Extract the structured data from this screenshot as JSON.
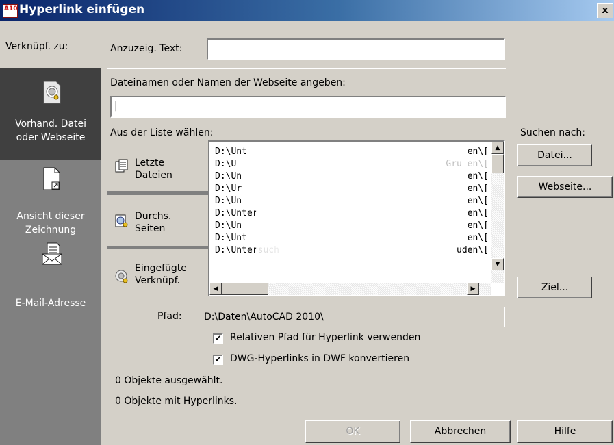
{
  "window": {
    "title": "Hyperlink einfügen",
    "close_glyph": "x",
    "logo_text": "A10"
  },
  "sidebar": {
    "header": "Verknüpf. zu:",
    "items": [
      {
        "label_line1": "Vorhand. Datei",
        "label_line2": "oder Webseite",
        "icon": "existing-file-icon",
        "selected": true
      },
      {
        "label_line1": "Ansicht dieser",
        "label_line2": "Zeichnung",
        "icon": "drawing-view-icon",
        "selected": false
      },
      {
        "label_line1": "E-Mail-Adresse",
        "label_line2": "",
        "icon": "email-icon",
        "selected": false
      }
    ]
  },
  "display_text": {
    "label": "Anzuzeig. Text:",
    "value": ""
  },
  "filename": {
    "label": "Dateinamen oder Namen der Webseite angeben:",
    "value": "|"
  },
  "list_section": {
    "label": "Aus der Liste wählen:",
    "tabs": [
      {
        "line1": "Letzte",
        "line2": "Dateien",
        "icon": "recent-files-icon"
      },
      {
        "line1": "Durchs.",
        "line2": "Seiten",
        "icon": "browsed-pages-icon"
      },
      {
        "line1": "Eingefügte",
        "line2": "Verknüpf.",
        "icon": "inserted-links-icon"
      }
    ],
    "rows": [
      {
        "left": "D:\\Unt",
        "right": "en\\[ "
      },
      {
        "left": "D:\\U",
        "right": "Gru en\\[ "
      },
      {
        "left": "D:\\Un",
        "right": "en\\[ "
      },
      {
        "left": "D:\\Ur",
        "right": "en\\[ "
      },
      {
        "left": "D:\\Un",
        "right": "en\\[ "
      },
      {
        "left": "D:\\Unter",
        "right": "en\\[ "
      },
      {
        "left": "D:\\Un",
        "right": "en\\[ "
      },
      {
        "left": "D:\\Unt",
        "right": "en\\[ "
      },
      {
        "left": "D:\\Untersuch",
        "right": "uden\\[ "
      }
    ]
  },
  "search": {
    "label": "Suchen nach:",
    "file_button": "Datei...",
    "web_button": "Webseite...",
    "target_button": "Ziel..."
  },
  "path": {
    "label": "Pfad:",
    "value": "D:\\Daten\\AutoCAD 2010\\"
  },
  "options": {
    "relative_path": {
      "label": "Relativen Pfad für Hyperlink verwenden",
      "checked": "✔"
    },
    "dwg_to_dwf": {
      "label": "DWG-Hyperlinks in DWF konvertieren",
      "checked": "✔"
    }
  },
  "status": {
    "selected": "0 Objekte ausgewählt.",
    "with_links": "0 Objekte mit Hyperlinks."
  },
  "footer": {
    "ok": "OK",
    "cancel": "Abbrechen",
    "help": "Hilfe"
  }
}
